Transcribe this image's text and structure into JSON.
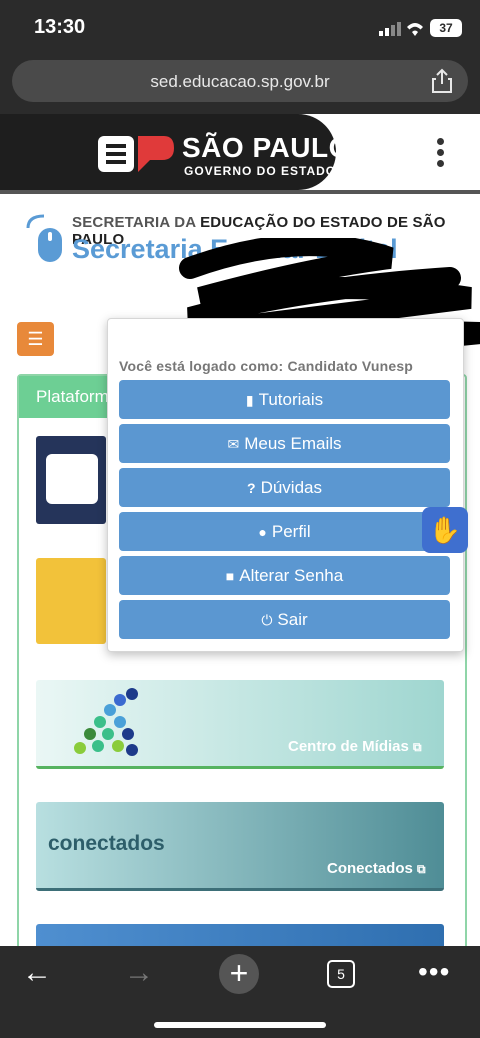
{
  "status": {
    "time": "13:30",
    "battery": "37"
  },
  "browser": {
    "url": "sed.educacao.sp.gov.br",
    "tab_count": "5"
  },
  "header": {
    "brand_title": "SÃO PAULO",
    "brand_subtitle": "GOVERNO DO ESTADO",
    "secretaria_prefix": "SECRETARIA DA ",
    "secretaria_bold": "EDUCAÇÃO DO ESTADO DE SÃO PAULO",
    "app_name": "Secretaria Escolar Digital"
  },
  "card": {
    "header_label": "Plataforma",
    "tiles": [
      {
        "label": "Centro de Mídias"
      },
      {
        "label": "Conectados",
        "logo_text": "conectados"
      }
    ]
  },
  "dropdown": {
    "logged_as": "Você está logado como: Candidato Vunesp",
    "items": [
      {
        "label": "Tutoriais",
        "icon": "book-icon"
      },
      {
        "label": "Meus Emails",
        "icon": "envelope-icon"
      },
      {
        "label": "Dúvidas",
        "icon": "question-icon"
      },
      {
        "label": "Perfil",
        "icon": "user-icon"
      },
      {
        "label": "Alterar Senha",
        "icon": "lock-icon"
      },
      {
        "label": "Sair",
        "icon": "power-icon"
      }
    ]
  },
  "colors": {
    "accent_blue": "#5b97d1",
    "orange": "#e8893a",
    "green": "#6dcf94"
  }
}
